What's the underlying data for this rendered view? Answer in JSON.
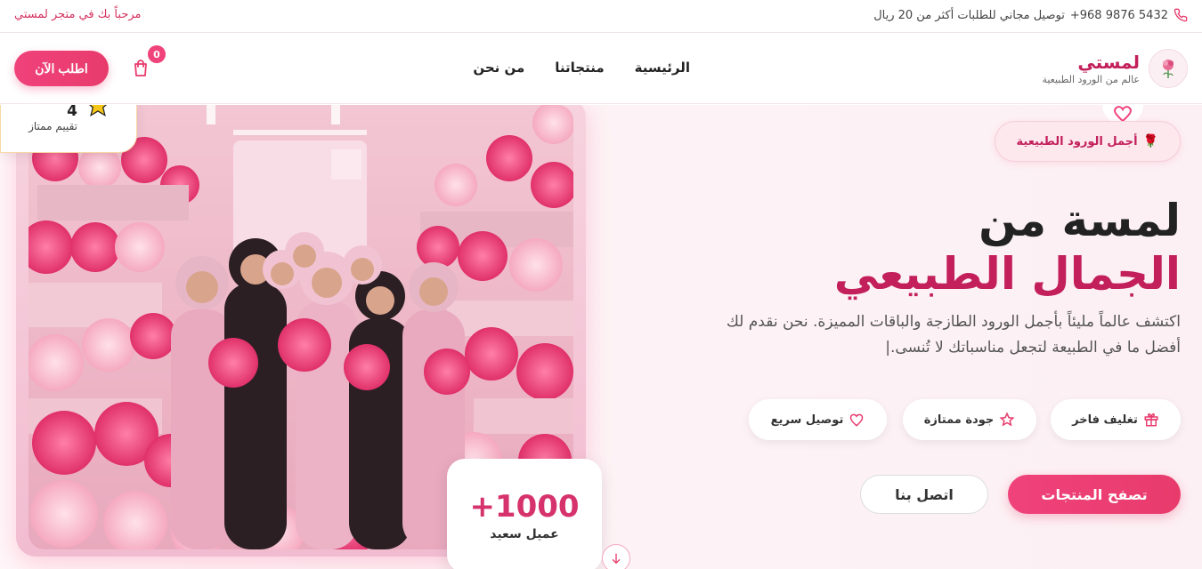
{
  "topbar": {
    "phone": "+968 9876 5432",
    "shipping": "توصيل مجاني للطلبات أكثر من 20 ريال",
    "welcome": "مرحباً بك في متجر لمستي"
  },
  "brand": {
    "name": "لمستي",
    "tagline": "عالم من الورود الطبيعية"
  },
  "nav": {
    "items": [
      "الرئيسية",
      "منتجاتنا",
      "من نحن"
    ]
  },
  "header": {
    "order_label": "اطلب الآن",
    "cart_count": "0"
  },
  "hero": {
    "tag": "أجمل الورود الطبيعية",
    "title_line1": "لمسة من",
    "title_line2": "الجمال الطبيعي",
    "description": "اكتشف عالماً مليئاً بأجمل الورود الطازجة والباقات المميزة. نحن نقدم لك أفضل ما في الطبيعة لتجعل مناسباتك لا تُنسى.|",
    "features": [
      "تغليف فاخر",
      "جودة ممتازة",
      "توصيل سريع"
    ],
    "browse_label": "تصفح المنتجات",
    "contact_label": "اتصل بنا",
    "rating_value": "4",
    "rating_label": "تقييم ممتاز",
    "stat_value": "+1000",
    "stat_label": "عميل سعيد"
  },
  "colors": {
    "accent": "#e83b6c",
    "brand": "#c21f5b",
    "star": "#f5c518"
  }
}
